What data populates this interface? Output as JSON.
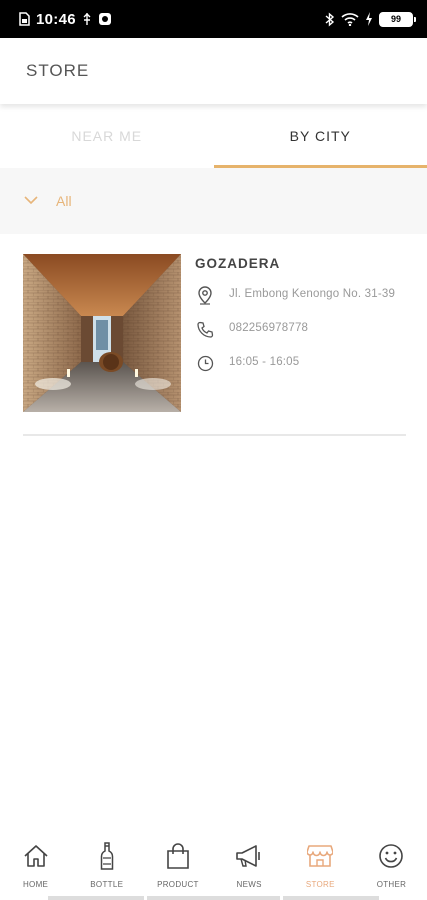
{
  "status_bar": {
    "time": "10:46",
    "battery": "99"
  },
  "app_bar": {
    "title": "STORE"
  },
  "tabs": [
    {
      "label": "NEAR ME",
      "active": false
    },
    {
      "label": "BY CITY",
      "active": true
    }
  ],
  "filter": {
    "label": "All",
    "icon": "chevron-down-icon"
  },
  "stores": [
    {
      "name": "GOZADERA",
      "address": "Jl. Embong Kenongo No. 31-39",
      "phone": "082256978778",
      "hours": "16:05 - 16:05",
      "image": "brick-corridor-photo"
    }
  ],
  "bottom_nav": [
    {
      "label": "HOME",
      "icon": "home-icon"
    },
    {
      "label": "BOTTLE",
      "icon": "bottle-icon"
    },
    {
      "label": "PRODUCT",
      "icon": "shopping-bag-icon"
    },
    {
      "label": "NEWS",
      "icon": "megaphone-icon"
    },
    {
      "label": "STORE",
      "icon": "store-icon",
      "active": true
    },
    {
      "label": "OTHER",
      "icon": "smiley-icon"
    }
  ],
  "colors": {
    "accent": "#e6b36b",
    "active_nav": "#e8a87c",
    "filter_text": "#e7b57a",
    "inactive_tab": "#d8d8d8"
  }
}
